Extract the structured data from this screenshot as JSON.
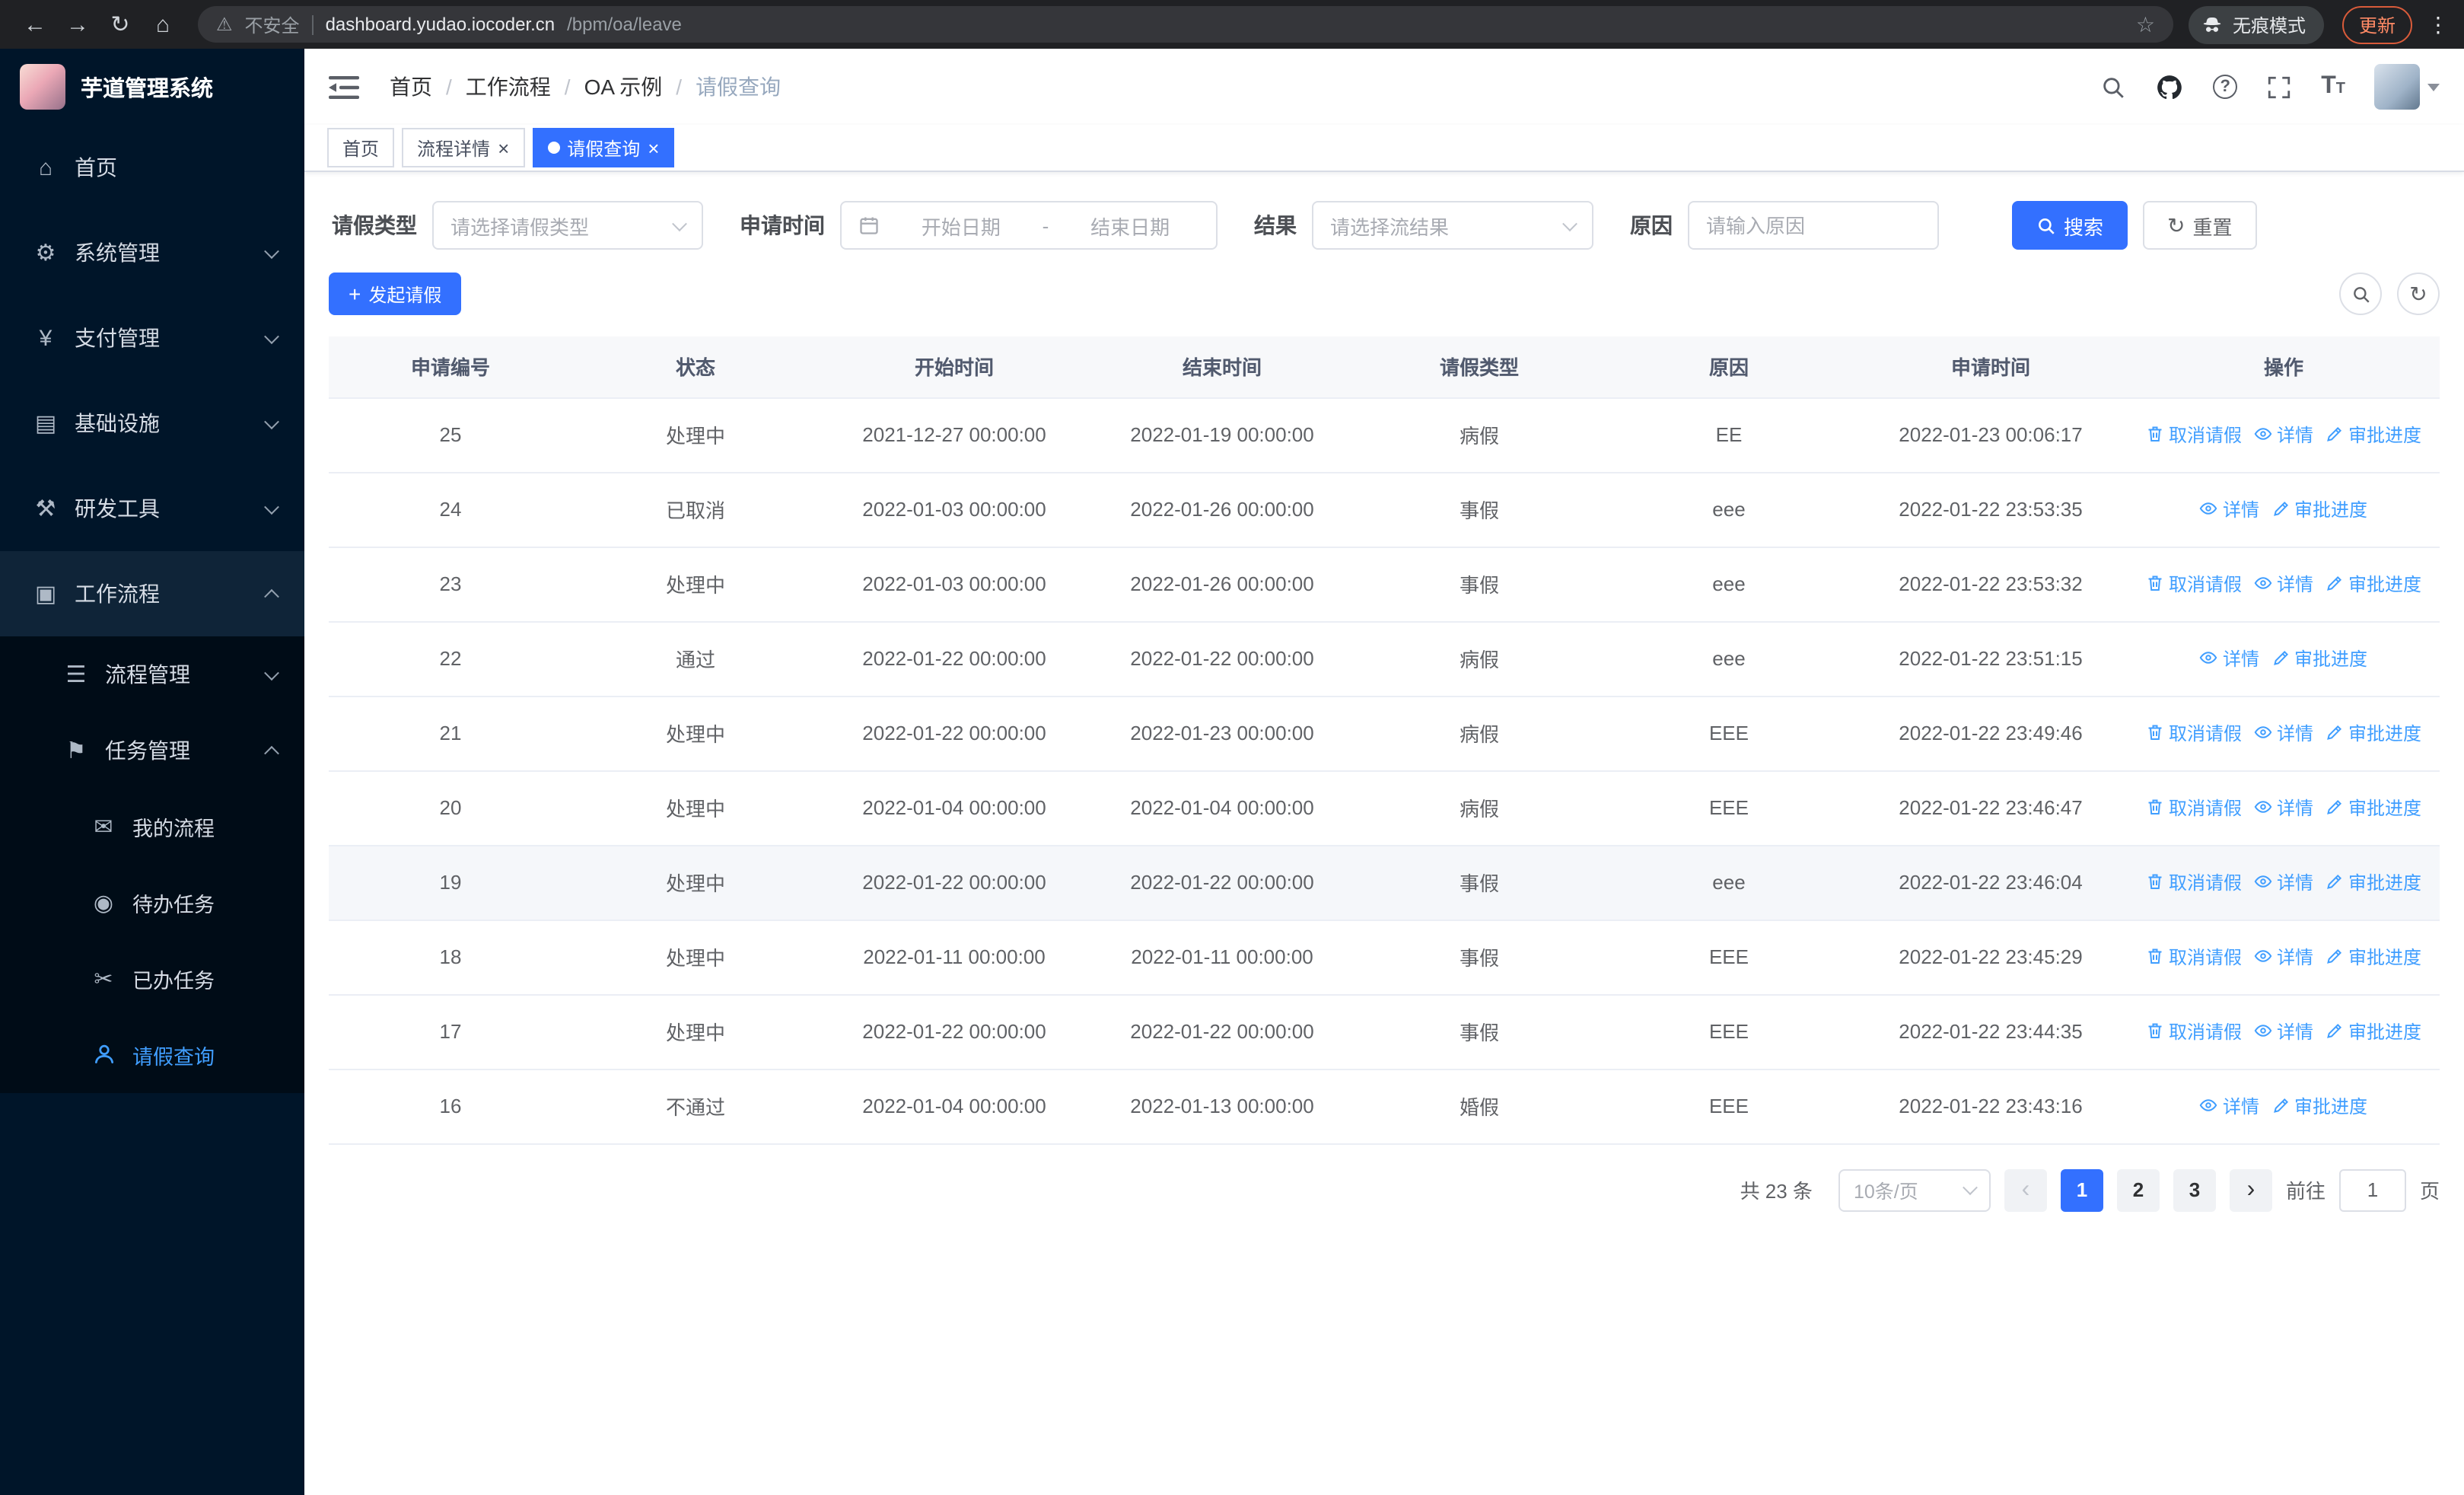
{
  "browser": {
    "security_label": "不安全",
    "url_host": "dashboard.yudao.iocoder.cn",
    "url_path": "/bpm/oa/leave",
    "incognito_label": "无痕模式",
    "update_label": "更新"
  },
  "sidebar": {
    "logo_title": "芋道管理系统",
    "items": [
      {
        "label": "首页",
        "icon": "dashboard",
        "level": 1
      },
      {
        "label": "系统管理",
        "icon": "gear",
        "level": 1,
        "chevron": "down"
      },
      {
        "label": "支付管理",
        "icon": "yen",
        "level": 1,
        "chevron": "down"
      },
      {
        "label": "基础设施",
        "icon": "infra",
        "level": 1,
        "chevron": "down"
      },
      {
        "label": "研发工具",
        "icon": "tool",
        "level": 1,
        "chevron": "down"
      },
      {
        "label": "工作流程",
        "icon": "workflow",
        "level": 1,
        "chevron": "up",
        "highlight": true
      },
      {
        "label": "流程管理",
        "icon": "list",
        "level": 2,
        "chevron": "down"
      },
      {
        "label": "任务管理",
        "icon": "task",
        "level": 2,
        "chevron": "up"
      },
      {
        "label": "我的流程",
        "icon": "message",
        "level": 3
      },
      {
        "label": "待办任务",
        "icon": "eye",
        "level": 3
      },
      {
        "label": "已办任务",
        "icon": "done",
        "level": 3
      },
      {
        "label": "请假查询",
        "icon": "user",
        "level": 3,
        "active": true
      }
    ]
  },
  "icons": {
    "dashboard": "⌂",
    "gear": "⚙",
    "yen": "¥",
    "infra": "▤",
    "tool": "⚒",
    "workflow": "▣",
    "list": "☰",
    "task": "⚑",
    "message": "✉",
    "eye": "◉",
    "done": "✂"
  },
  "header": {
    "breadcrumb": [
      "首页",
      "工作流程",
      "OA 示例",
      "请假查询"
    ]
  },
  "tabs": [
    {
      "label": "首页",
      "closable": false,
      "active": false
    },
    {
      "label": "流程详情",
      "closable": true,
      "active": false
    },
    {
      "label": "请假查询",
      "closable": true,
      "active": true
    }
  ],
  "filters": {
    "leave_type_label": "请假类型",
    "leave_type_placeholder": "请选择请假类型",
    "apply_time_label": "申请时间",
    "start_date_placeholder": "开始日期",
    "range_separator": "-",
    "end_date_placeholder": "结束日期",
    "result_label": "结果",
    "result_placeholder": "请选择流结果",
    "reason_label": "原因",
    "reason_placeholder": "请输入原因",
    "search_label": "搜索",
    "reset_label": "重置"
  },
  "toolbar": {
    "create_label": "发起请假"
  },
  "table": {
    "columns": [
      "申请编号",
      "状态",
      "开始时间",
      "结束时间",
      "请假类型",
      "原因",
      "申请时间",
      "操作"
    ],
    "action_labels": {
      "cancel": "取消请假",
      "detail": "详情",
      "progress": "审批进度"
    },
    "rows": [
      {
        "id": "25",
        "status": "处理中",
        "start": "2021-12-27 00:00:00",
        "end": "2022-01-19 00:00:00",
        "type": "病假",
        "reason": "EE",
        "apply_time": "2022-01-23 00:06:17",
        "actions": [
          "cancel",
          "detail",
          "progress"
        ],
        "highlighted": false
      },
      {
        "id": "24",
        "status": "已取消",
        "start": "2022-01-03 00:00:00",
        "end": "2022-01-26 00:00:00",
        "type": "事假",
        "reason": "eee",
        "apply_time": "2022-01-22 23:53:35",
        "actions": [
          "detail",
          "progress"
        ],
        "highlighted": false
      },
      {
        "id": "23",
        "status": "处理中",
        "start": "2022-01-03 00:00:00",
        "end": "2022-01-26 00:00:00",
        "type": "事假",
        "reason": "eee",
        "apply_time": "2022-01-22 23:53:32",
        "actions": [
          "cancel",
          "detail",
          "progress"
        ],
        "highlighted": false
      },
      {
        "id": "22",
        "status": "通过",
        "start": "2022-01-22 00:00:00",
        "end": "2022-01-22 00:00:00",
        "type": "病假",
        "reason": "eee",
        "apply_time": "2022-01-22 23:51:15",
        "actions": [
          "detail",
          "progress"
        ],
        "highlighted": false
      },
      {
        "id": "21",
        "status": "处理中",
        "start": "2022-01-22 00:00:00",
        "end": "2022-01-23 00:00:00",
        "type": "病假",
        "reason": "EEE",
        "apply_time": "2022-01-22 23:49:46",
        "actions": [
          "cancel",
          "detail",
          "progress"
        ],
        "highlighted": false
      },
      {
        "id": "20",
        "status": "处理中",
        "start": "2022-01-04 00:00:00",
        "end": "2022-01-04 00:00:00",
        "type": "病假",
        "reason": "EEE",
        "apply_time": "2022-01-22 23:46:47",
        "actions": [
          "cancel",
          "detail",
          "progress"
        ],
        "highlighted": false
      },
      {
        "id": "19",
        "status": "处理中",
        "start": "2022-01-22 00:00:00",
        "end": "2022-01-22 00:00:00",
        "type": "事假",
        "reason": "eee",
        "apply_time": "2022-01-22 23:46:04",
        "actions": [
          "cancel",
          "detail",
          "progress"
        ],
        "highlighted": true
      },
      {
        "id": "18",
        "status": "处理中",
        "start": "2022-01-11 00:00:00",
        "end": "2022-01-11 00:00:00",
        "type": "事假",
        "reason": "EEE",
        "apply_time": "2022-01-22 23:45:29",
        "actions": [
          "cancel",
          "detail",
          "progress"
        ],
        "highlighted": false
      },
      {
        "id": "17",
        "status": "处理中",
        "start": "2022-01-22 00:00:00",
        "end": "2022-01-22 00:00:00",
        "type": "事假",
        "reason": "EEE",
        "apply_time": "2022-01-22 23:44:35",
        "actions": [
          "cancel",
          "detail",
          "progress"
        ],
        "highlighted": false
      },
      {
        "id": "16",
        "status": "不通过",
        "start": "2022-01-04 00:00:00",
        "end": "2022-01-13 00:00:00",
        "type": "婚假",
        "reason": "EEE",
        "apply_time": "2022-01-22 23:43:16",
        "actions": [
          "detail",
          "progress"
        ],
        "highlighted": false
      }
    ]
  },
  "pagination": {
    "total_text": "共 23 条",
    "page_size_text": "10条/页",
    "pages": [
      "1",
      "2",
      "3"
    ],
    "active_page": "1",
    "goto_prefix": "前往",
    "goto_value": "1",
    "goto_suffix": "页"
  },
  "colors": {
    "primary": "#3370ff",
    "link": "#409eff",
    "sidebar_bg": "#001529",
    "submenu_bg": "#000c17"
  }
}
